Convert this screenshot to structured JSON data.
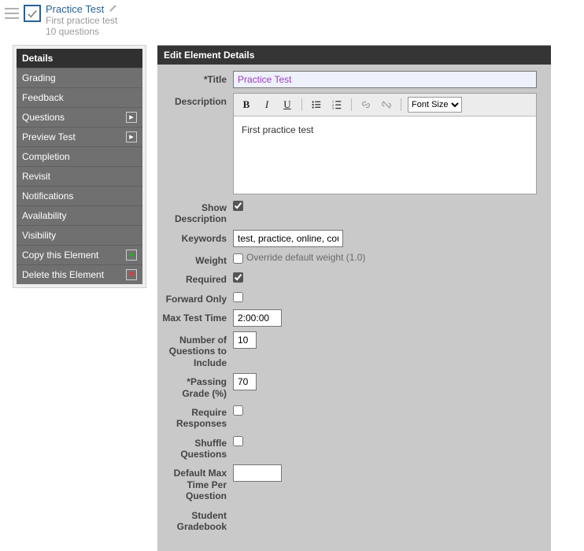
{
  "header": {
    "title": "Practice Test",
    "subtitle": "First practice test",
    "question_count": "10 questions"
  },
  "sidebar": {
    "items": [
      {
        "label": "Details",
        "active": true,
        "icon": null
      },
      {
        "label": "Grading",
        "active": false,
        "icon": null
      },
      {
        "label": "Feedback",
        "active": false,
        "icon": null
      },
      {
        "label": "Questions",
        "active": false,
        "icon": "expand"
      },
      {
        "label": "Preview Test",
        "active": false,
        "icon": "expand"
      },
      {
        "label": "Completion",
        "active": false,
        "icon": null
      },
      {
        "label": "Revisit",
        "active": false,
        "icon": null
      },
      {
        "label": "Notifications",
        "active": false,
        "icon": null
      },
      {
        "label": "Availability",
        "active": false,
        "icon": null
      },
      {
        "label": "Visibility",
        "active": false,
        "icon": null
      },
      {
        "label": "Copy this Element",
        "active": false,
        "icon": "plus"
      },
      {
        "label": "Delete this Element",
        "active": false,
        "icon": "x"
      }
    ]
  },
  "panel": {
    "header": "Edit Element Details",
    "labels": {
      "title": "*Title",
      "description": "Description",
      "show_description": "Show Description",
      "keywords": "Keywords",
      "weight": "Weight",
      "weight_checkbox": "Override default weight (1.0)",
      "required": "Required",
      "forward_only": "Forward Only",
      "max_test_time": "Max Test Time",
      "num_questions": "Number of Questions to Include",
      "passing_grade": "*Passing Grade (%)",
      "require_responses": "Require Responses",
      "shuffle_questions": "Shuffle Questions",
      "default_max_time": "Default Max Time Per Question",
      "student_gradebook": "Student Gradebook"
    },
    "values": {
      "title": "Practice Test",
      "description_body": "First practice test",
      "show_description_checked": true,
      "keywords": "test, practice, online, cours",
      "weight_override_checked": false,
      "required_checked": true,
      "forward_only_checked": false,
      "max_test_time": "2:00:00",
      "num_questions": "10",
      "passing_grade": "70",
      "require_responses_checked": false,
      "shuffle_questions_checked": false,
      "default_max_time": ""
    },
    "richtext": {
      "font_size_label": "Font Size"
    }
  }
}
